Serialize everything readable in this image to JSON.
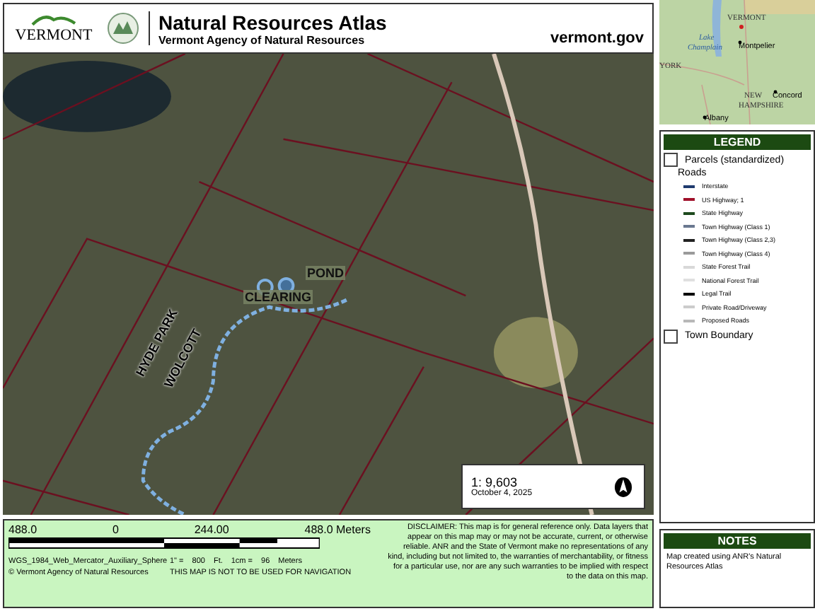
{
  "header": {
    "logo_text": "VERMONT",
    "title": "Natural Resources Atlas",
    "subtitle": "Vermont Agency of Natural Resources",
    "site": "vermont.gov"
  },
  "map": {
    "labels": [
      {
        "text": "HYDE PARK",
        "kind": "boundary"
      },
      {
        "text": "WOLCOTT",
        "kind": "boundary"
      },
      {
        "text": "POND",
        "kind": "feature"
      },
      {
        "text": "CLEARING",
        "kind": "feature"
      }
    ],
    "scale_box": {
      "ratio": "1:  9,603",
      "date": "October 4, 2025"
    }
  },
  "overview_map": {
    "labels": [
      {
        "text": "VERMONT",
        "kind": "state"
      },
      {
        "text": "Lake",
        "kind": "water"
      },
      {
        "text": "Champlain",
        "kind": "water"
      },
      {
        "text": "Montpelier",
        "kind": "city"
      },
      {
        "text": "YORK",
        "kind": "state"
      },
      {
        "text": "Concord",
        "kind": "city"
      },
      {
        "text": "NEW",
        "kind": "state"
      },
      {
        "text": "HAMPSHIRE",
        "kind": "state"
      },
      {
        "text": "Albany",
        "kind": "city"
      }
    ]
  },
  "legend": {
    "title": "LEGEND",
    "items": [
      {
        "label": "Parcels (standardized)",
        "kind": "box"
      },
      {
        "label": "Roads",
        "kind": "heading"
      },
      {
        "label": "Interstate",
        "kind": "line",
        "color": "#1f3a6e"
      },
      {
        "label": "US Highway; 1",
        "kind": "line",
        "color": "#a0102a"
      },
      {
        "label": "State Highway",
        "kind": "line",
        "color": "#1e4a1e"
      },
      {
        "label": "Town Highway (Class 1)",
        "kind": "line",
        "color": "#6a7890"
      },
      {
        "label": "Town Highway (Class 2,3)",
        "kind": "line",
        "color": "#222222"
      },
      {
        "label": "Town Highway (Class 4)",
        "kind": "line",
        "color": "#9a9a9a"
      },
      {
        "label": "State Forest Trail",
        "kind": "line",
        "color": "#d8d8d8"
      },
      {
        "label": "National Forest Trail",
        "kind": "line",
        "color": "#e0e0e0"
      },
      {
        "label": "Legal Trail",
        "kind": "line",
        "color": "#000000"
      },
      {
        "label": "Private Road/Driveway",
        "kind": "line",
        "color": "#cccccc"
      },
      {
        "label": "Proposed Roads",
        "kind": "line",
        "color": "#b8b8b8"
      },
      {
        "label": "Town Boundary",
        "kind": "box"
      }
    ]
  },
  "scale_bar": {
    "ticks": [
      "488.0",
      "0",
      "244.00",
      "488.0 Meters"
    ],
    "projection": "WGS_1984_Web_Mercator_Auxiliary_Sphere",
    "inch_label": "1\" =",
    "inch_value": "800",
    "inch_unit": "Ft.",
    "cm_label": "1cm =",
    "cm_value": "96",
    "cm_unit": "Meters",
    "credit": "© Vermont Agency of Natural Resources",
    "warning": "THIS MAP IS NOT TO BE USED FOR NAVIGATION",
    "disclaimer": "DISCLAIMER: This map is for general reference only. Data layers that appear on this map may or may not be accurate, current, or otherwise reliable. ANR and the State of Vermont make no representations of any kind, including but not limited to, the warranties of merchantability, or fitness for a particular use, nor are any such warranties to be implied with respect to the data on this map."
  },
  "notes": {
    "title": "NOTES",
    "text": "Map created using ANR's Natural Resources Atlas"
  }
}
